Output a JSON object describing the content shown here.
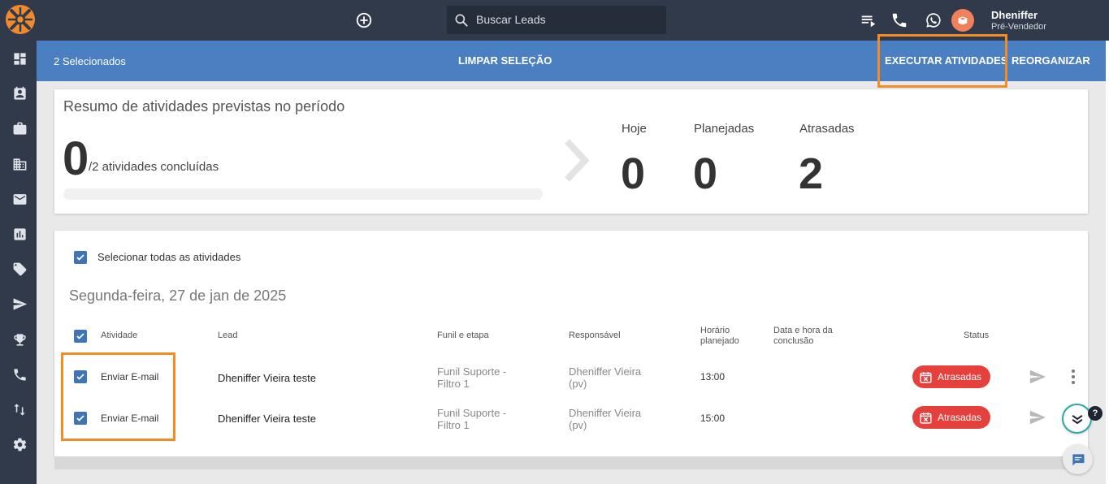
{
  "topbar": {
    "search_placeholder": "Buscar Leads",
    "user_name": "Dheniffer",
    "user_role": "Pré-Vendedor"
  },
  "sidebar": {
    "items": [
      "dashboard-icon",
      "contacts-icon",
      "briefcase-icon",
      "building-icon",
      "mail-icon",
      "reports-icon",
      "tags-icon",
      "send-icon",
      "trophy-icon",
      "phone-icon",
      "flow-icon",
      "settings-icon"
    ]
  },
  "selection_bar": {
    "count_label": "2 Selecionados",
    "clear_label": "LIMPAR SELEÇÃO",
    "execute_label": "EXECUTAR ATIVIDADES",
    "reorganize_label": "REORGANIZAR"
  },
  "summary": {
    "title": "Resumo de atividades previstas no período",
    "completed": "0",
    "completed_suffix": "/2 atividades concluídas",
    "progress_fraction": 0,
    "stats": [
      {
        "label": "Hoje",
        "value": "0"
      },
      {
        "label": "Planejadas",
        "value": "0"
      },
      {
        "label": "Atrasadas",
        "value": "2"
      }
    ]
  },
  "activities": {
    "select_all_label": "Selecionar todas as atividades",
    "day_title": "Segunda-feira, 27 de jan de 2025",
    "columns": {
      "activity": "Atividade",
      "lead": "Lead",
      "funnel_1": "Funil e etapa",
      "owner": "Responsável",
      "planned_1": "Horário",
      "planned_2": "planejado",
      "done_1": "Data e hora da",
      "done_2": "conclusão",
      "status": "Status"
    },
    "rows": [
      {
        "activity": "Enviar E-mail",
        "lead": "Dheniffer Vieira teste",
        "funnel_1": "Funil Suporte -",
        "funnel_2": "Filtro 1",
        "owner_1": "Dheniffer Vieira",
        "owner_2": "(pv)",
        "time": "13:00",
        "status": "Atrasadas"
      },
      {
        "activity": "Enviar E-mail",
        "lead": "Dheniffer Vieira teste",
        "funnel_1": "Funil Suporte -",
        "funnel_2": "Filtro 1",
        "owner_1": "Dheniffer Vieira",
        "owner_2": "(pv)",
        "time": "15:00",
        "status": "Atrasadas"
      }
    ]
  },
  "help_badge": "?",
  "colors": {
    "dark": "#313a4a",
    "selection_bar": "#4a7fc1",
    "highlight": "#f28c28",
    "status_late": "#e6403c",
    "checkbox": "#3f74b5"
  }
}
